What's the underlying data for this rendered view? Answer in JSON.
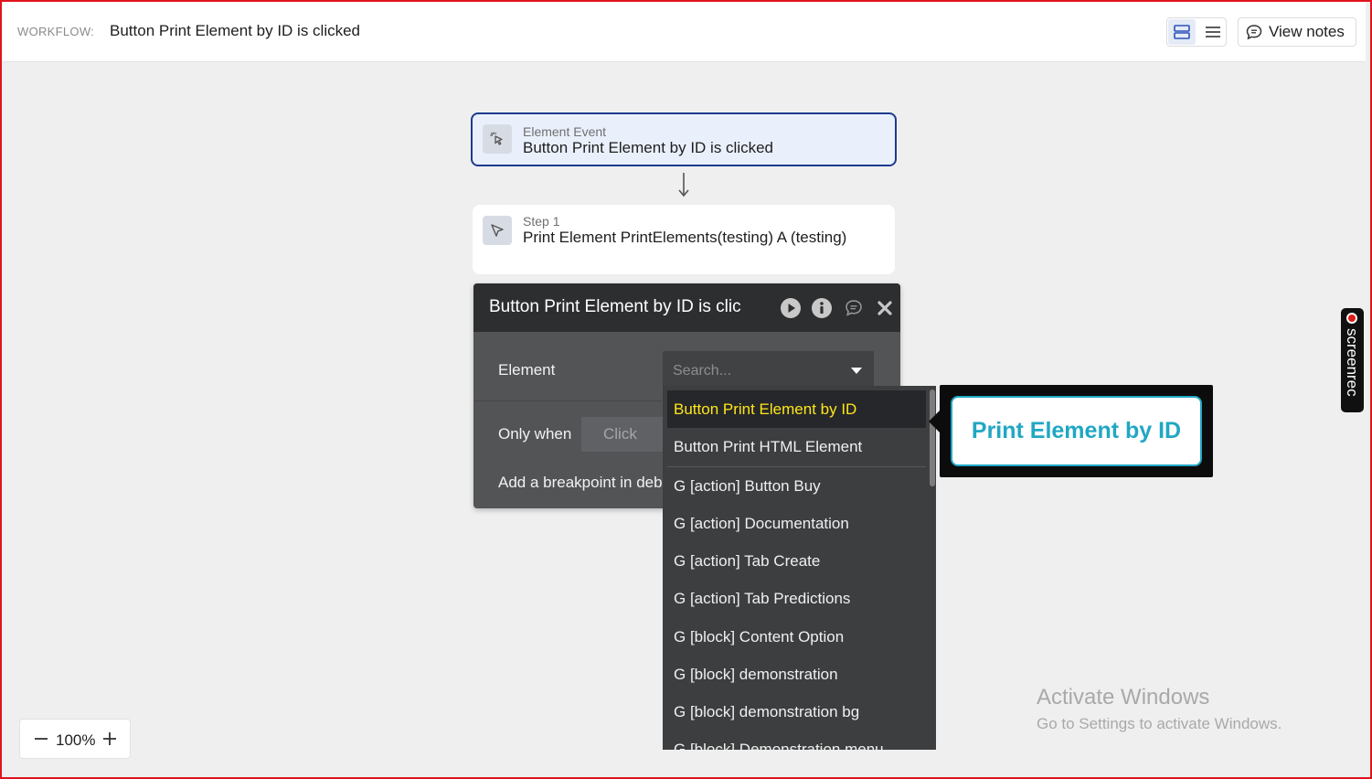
{
  "header": {
    "workflow_label": "WORKFLOW:",
    "workflow_title": "Button Print Element by ID is clicked",
    "view_notes_label": "View notes"
  },
  "event_card": {
    "subtitle": "Element Event",
    "title": "Button Print Element by ID is clicked"
  },
  "step_card": {
    "subtitle": "Step 1",
    "title": "Print Element PrintElements(testing) A (testing)"
  },
  "panel": {
    "title": "Button Print Element by ID is clic",
    "element_label": "Element",
    "search_placeholder": "Search...",
    "only_when_label": "Only when",
    "click_placeholder": "Click",
    "breakpoint_label": "Add a breakpoint in deb"
  },
  "dropdown": {
    "items": [
      "Button Print Element by ID",
      "Button Print HTML Element",
      "G [action] Button Buy",
      "G [action] Documentation",
      "G [action] Tab Create",
      "G [action] Tab Predictions",
      "G [block] Content Option",
      "G [block] demonstration",
      "G [block] demonstration bg",
      "G [block] Demonstration menu"
    ],
    "selected_index": 0
  },
  "preview": {
    "button_label": "Print Element by ID",
    "accent_color": "#20a7c4"
  },
  "screenrec": {
    "label": "screenrec"
  },
  "watermark": {
    "title": "Activate Windows",
    "subtitle": "Go to Settings to activate Windows."
  },
  "zoom": {
    "level": "100%"
  },
  "icons": {
    "view_mode": [
      "stack-view-icon",
      "list-view-icon"
    ],
    "notes": "chat-bubble-icon",
    "event": "click-cursor-icon",
    "step": "pointer-arrow-icon",
    "panel_actions": [
      "play-icon",
      "info-icon",
      "comment-icon",
      "close-icon"
    ]
  },
  "colors": {
    "event_border": "#1d3c8f",
    "selected_item_text": "#ffe619",
    "frame_border": "#e0141e"
  }
}
